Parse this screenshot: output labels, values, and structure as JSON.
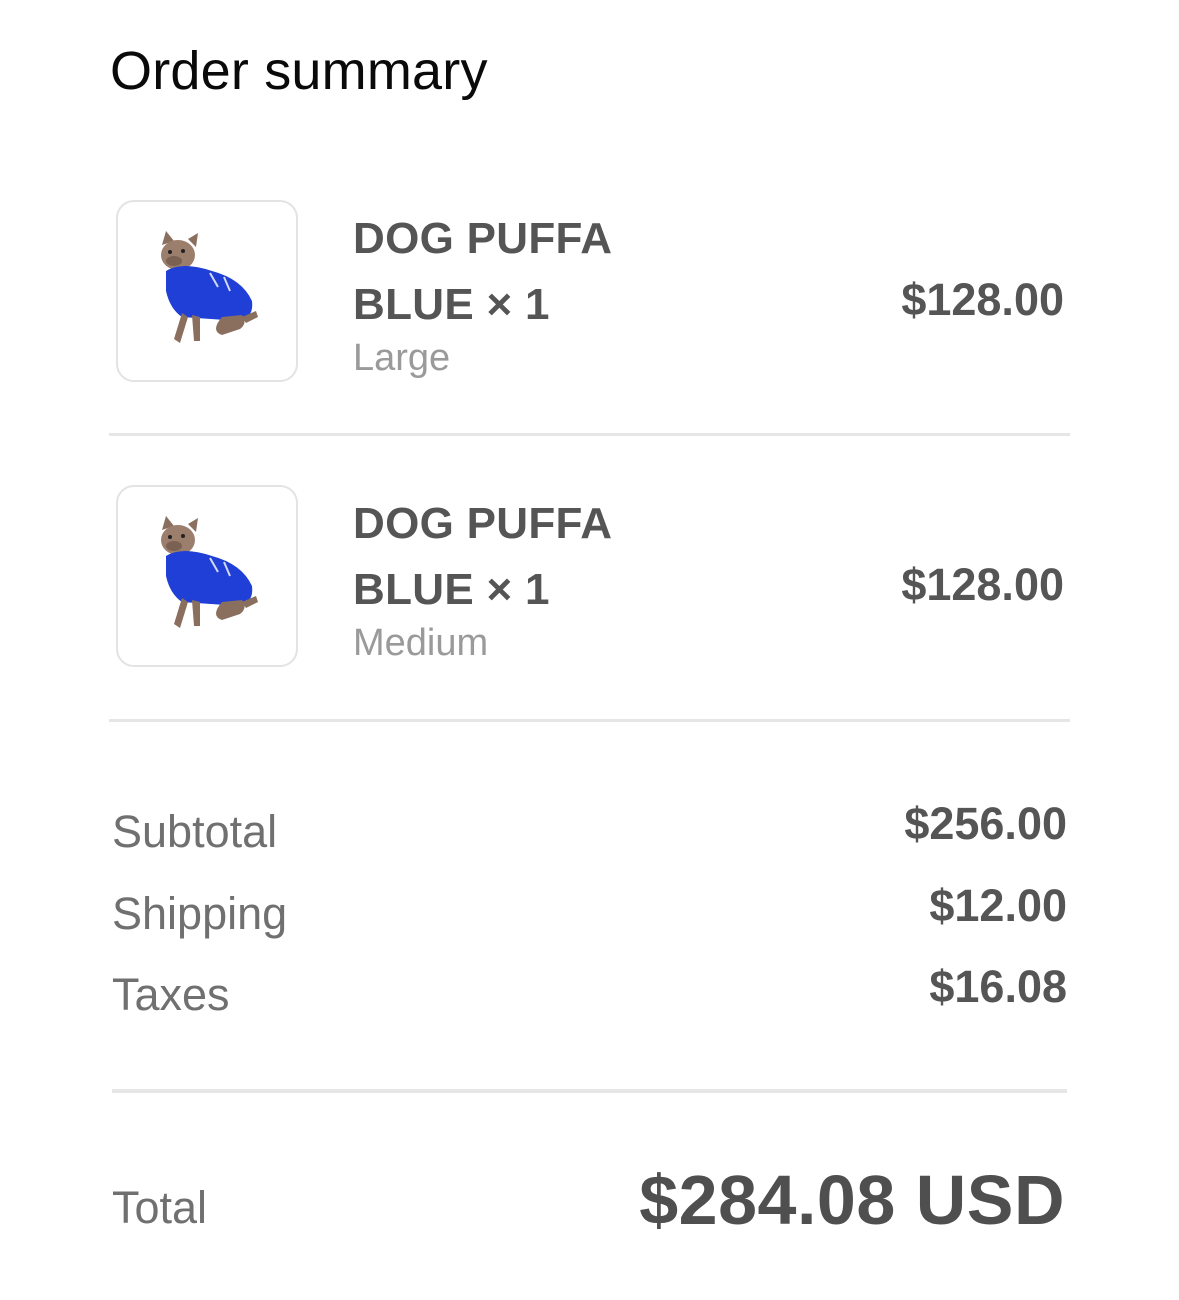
{
  "page": {
    "title": "Order summary"
  },
  "items": [
    {
      "name": "DOG PUFFA BLUE × 1",
      "variant": "Large",
      "price": "$128.00",
      "image_icon": "dog-puffa-product-image"
    },
    {
      "name": "DOG PUFFA BLUE × 1",
      "variant": "Medium",
      "price": "$128.00",
      "image_icon": "dog-puffa-product-image"
    }
  ],
  "summary": {
    "subtotal_label": "Subtotal",
    "subtotal_value": "$256.00",
    "shipping_label": "Shipping",
    "shipping_value": "$12.00",
    "taxes_label": "Taxes",
    "taxes_value": "$16.08"
  },
  "total": {
    "label": "Total",
    "value": "$284.08 USD"
  },
  "colors": {
    "text_dark": "#0a0a0a",
    "text_primary": "#555555",
    "text_secondary": "#707070",
    "text_muted": "#9a9a9a",
    "divider": "#e6e6e6",
    "product_blue": "#1f3fd6"
  }
}
